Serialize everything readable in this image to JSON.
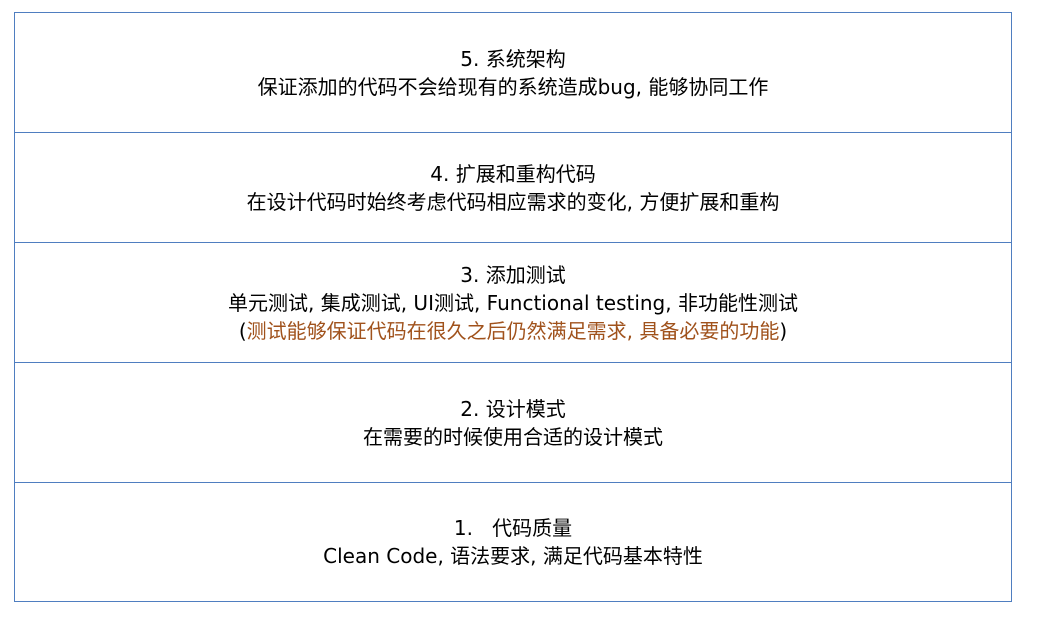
{
  "colors": {
    "border": "#4f7ec0",
    "text": "#000000",
    "note": "#a0521c"
  },
  "layers": [
    {
      "title": "5. 系统架构",
      "desc": "保证添加的代码不会给现有的系统造成bug, 能够协同工作"
    },
    {
      "title": "4. 扩展和重构代码",
      "desc": "在设计代码时始终考虑代码相应需求的变化, 方便扩展和重构"
    },
    {
      "title": "3. 添加测试",
      "desc": "单元测试, 集成测试, UI测试, Functional testing, 非功能性测试",
      "note_open": "(",
      "note": "测试能够保证代码在很久之后仍然满足需求, 具备必要的功能",
      "note_close": ")"
    },
    {
      "title": "2. 设计模式",
      "desc": "在需要的时候使用合适的设计模式"
    },
    {
      "title": "1.   代码质量",
      "desc": "Clean Code, 语法要求, 满足代码基本特性"
    }
  ]
}
